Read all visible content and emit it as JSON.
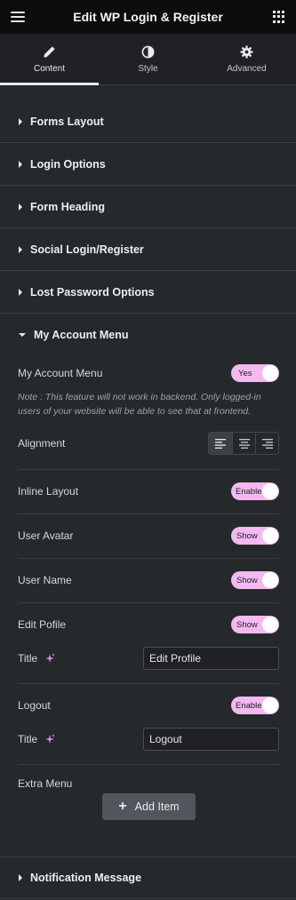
{
  "header": {
    "title": "Edit WP Login & Register",
    "menu_icon": "hamburger-icon",
    "apps_icon": "grid-icon"
  },
  "tabs": [
    {
      "label": "Content",
      "icon": "pencil-icon",
      "active": true
    },
    {
      "label": "Style",
      "icon": "half-circle-icon",
      "active": false
    },
    {
      "label": "Advanced",
      "icon": "gear-icon",
      "active": false
    }
  ],
  "sections": {
    "forms_layout": "Forms Layout",
    "login_options": "Login Options",
    "form_heading": "Form Heading",
    "social_login": "Social Login/Register",
    "lost_password": "Lost Password Options",
    "my_account_menu": "My Account Menu",
    "notification_message": "Notification Message"
  },
  "my_account": {
    "menu_label": "My Account Menu",
    "menu_toggle": "Yes",
    "note": "Note : This feature will not work in backend. Only logged-in users of your website will be able to see that at frontend.",
    "alignment_label": "Alignment",
    "alignment_options": [
      "left",
      "center",
      "right"
    ],
    "alignment_selected": "left",
    "inline_layout_label": "Inline Layout",
    "inline_layout_toggle": "Enable",
    "user_avatar_label": "User Avatar",
    "user_avatar_toggle": "Show",
    "user_name_label": "User Name",
    "user_name_toggle": "Show",
    "edit_profile_label": "Edit Pofile",
    "edit_profile_toggle": "Show",
    "edit_title_label": "Title",
    "edit_title_value": "Edit Profile",
    "logout_label": "Logout",
    "logout_toggle": "Enable",
    "logout_title_label": "Title",
    "logout_title_value": "Logout",
    "extra_menu_label": "Extra Menu",
    "add_item_label": "Add Item"
  },
  "colors": {
    "toggle_on": "#f3b9f0",
    "ai_sparkle": "#e88bf0",
    "background": "#26292c",
    "header": "#0c0d0e"
  }
}
